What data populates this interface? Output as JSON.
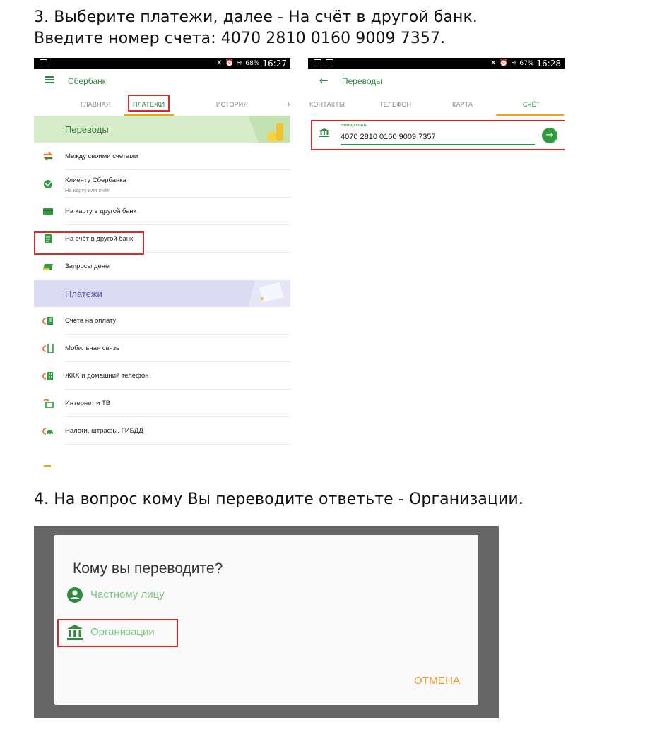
{
  "step3": {
    "line1": "3. Выберите платежи, далее - На счёт в другой банк.",
    "line2": "Введите номер счета: 4070 2810 0160 9009 7357."
  },
  "step4": {
    "text": "4. На вопрос кому Вы переводите ответьте - Организации."
  },
  "screen1": {
    "status": {
      "battery": "68%",
      "time": "16:27"
    },
    "app_title": "Сбербанк",
    "tabs": [
      "ГЛАВНАЯ",
      "ПЛАТЕЖИ",
      "ИСТОРИЯ",
      "К"
    ],
    "active_tab": "ПЛАТЕЖИ",
    "section_transfers": "Переводы",
    "transfers": [
      {
        "label": "Между своими счетами",
        "icon": "arrows-swap-icon"
      },
      {
        "label": "Клиенту Сбербанка",
        "sub": "На карту или счёт",
        "icon": "sberbank-logo-icon"
      },
      {
        "label": "На карту в другой банк",
        "icon": "card-icon"
      },
      {
        "label": "На счёт в другой банк",
        "icon": "document-icon"
      },
      {
        "label": "Запросы денег",
        "icon": "money-request-icon"
      }
    ],
    "section_payments": "Платежи",
    "payments": [
      {
        "label": "Счета на оплату",
        "icon": "invoice-icon"
      },
      {
        "label": "Мобильная связь",
        "icon": "mobile-phone-icon"
      },
      {
        "label": "ЖКХ и домашний телефон",
        "icon": "building-icon"
      },
      {
        "label": "Интернет и ТВ",
        "icon": "internet-tv-icon"
      },
      {
        "label": "Налоги, штрафы, ГИБДД",
        "icon": "car-icon"
      }
    ]
  },
  "screen2": {
    "status": {
      "battery": "67%",
      "time": "16:28"
    },
    "app_title": "Переводы",
    "tabs": [
      "КОНТАКТЫ",
      "ТЕЛЕФОН",
      "КАРТА",
      "СЧЁТ"
    ],
    "active_tab": "СЧЁТ",
    "field_label": "Номер счёта",
    "field_value": "4070 2810 0160 9009 7357"
  },
  "dialog": {
    "title": "Кому вы переводите?",
    "options": [
      {
        "label": "Частному лицу",
        "icon": "person-icon"
      },
      {
        "label": "Организации",
        "icon": "bank-building-icon"
      }
    ],
    "cancel": "ОТМЕНА"
  },
  "colors": {
    "sber_green": "#2e8b3e",
    "highlight_red": "#d52b2b",
    "tab_underline": "#f0a400",
    "cancel_orange": "#f09a2a"
  }
}
